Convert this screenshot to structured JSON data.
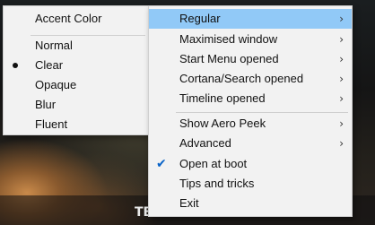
{
  "submenu": {
    "header": "Accent Color",
    "options": [
      "Normal",
      "Clear",
      "Opaque",
      "Blur",
      "Fluent"
    ],
    "selected": "Clear"
  },
  "menu": {
    "items": [
      {
        "label": "Regular",
        "has_submenu": true
      },
      {
        "label": "Maximised window",
        "has_submenu": true
      },
      {
        "label": "Start Menu opened",
        "has_submenu": true
      },
      {
        "label": "Cortana/Search opened",
        "has_submenu": true
      },
      {
        "label": "Timeline opened",
        "has_submenu": true
      },
      {
        "label": "Show Aero Peek",
        "has_submenu": true
      },
      {
        "label": "Advanced",
        "has_submenu": true
      },
      {
        "label": "Open at boot",
        "checked": true
      },
      {
        "label": "Tips and tricks"
      },
      {
        "label": "Exit"
      }
    ],
    "highlighted": "Regular"
  },
  "icons": {
    "arrow": "chevron-right-icon",
    "check": "checkmark-icon",
    "bullet": "radio-bullet-icon",
    "tray": "translucenttb-tray-icon"
  },
  "colors": {
    "highlight": "#91c9f7",
    "check": "#0a64c8"
  }
}
